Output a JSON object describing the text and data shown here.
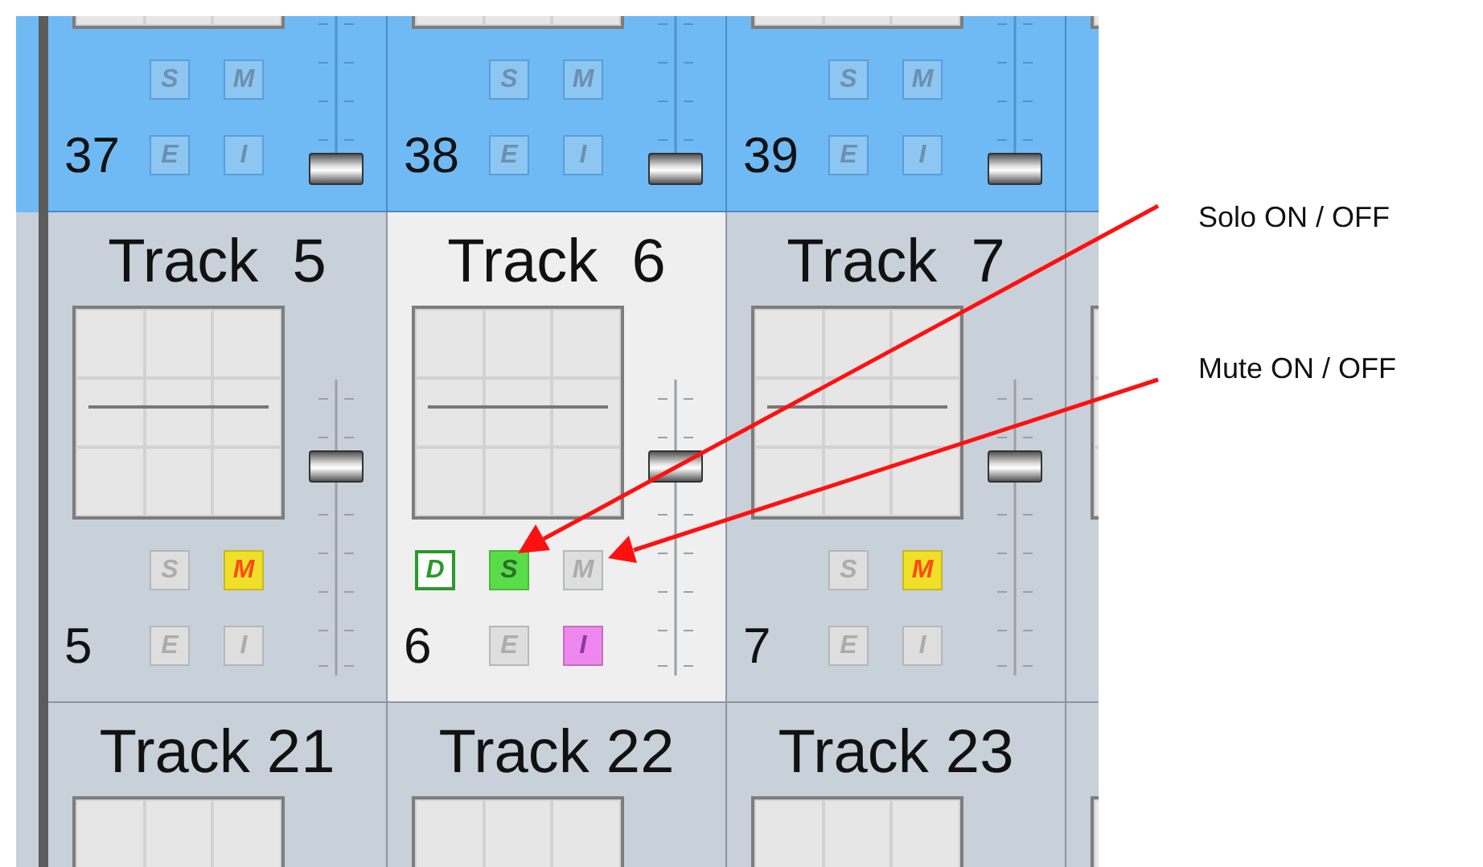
{
  "rows": [
    {
      "highlighted": true,
      "strips": [
        {
          "selected": false,
          "number": "37",
          "fader": {
            "level": 0
          },
          "buttons": [
            {
              "kind": "solo",
              "label": "S",
              "on": false
            },
            {
              "kind": "mute",
              "label": "M",
              "on": false
            },
            {
              "kind": "edit",
              "label": "E",
              "on": false
            },
            {
              "kind": "input",
              "label": "I",
              "on": false
            }
          ]
        },
        {
          "selected": false,
          "number": "38",
          "fader": {
            "level": 0
          },
          "buttons": [
            {
              "kind": "solo",
              "label": "S",
              "on": false
            },
            {
              "kind": "mute",
              "label": "M",
              "on": false
            },
            {
              "kind": "edit",
              "label": "E",
              "on": false
            },
            {
              "kind": "input",
              "label": "I",
              "on": false
            }
          ]
        },
        {
          "selected": false,
          "number": "39",
          "fader": {
            "level": 0
          },
          "buttons": [
            {
              "kind": "solo",
              "label": "S",
              "on": false
            },
            {
              "kind": "mute",
              "label": "M",
              "on": false
            },
            {
              "kind": "edit",
              "label": "E",
              "on": false
            },
            {
              "kind": "input",
              "label": "I",
              "on": false
            }
          ]
        },
        {
          "cut": true
        }
      ]
    },
    {
      "highlighted": false,
      "strips": [
        {
          "selected": false,
          "name": "Track  5",
          "number": "5",
          "fader": {
            "level": 0.73
          },
          "buttons": [
            {
              "kind": "solo",
              "label": "S",
              "on": false
            },
            {
              "kind": "mute",
              "label": "M",
              "on": true
            },
            {
              "kind": "edit",
              "label": "E",
              "on": false
            },
            {
              "kind": "input",
              "label": "I",
              "on": false
            }
          ]
        },
        {
          "selected": true,
          "name": "Track  6",
          "number": "6",
          "fader": {
            "level": 0.73
          },
          "buttons": [
            {
              "kind": "display",
              "label": "D",
              "on": true
            },
            {
              "kind": "solo",
              "label": "S",
              "on": true
            },
            {
              "kind": "mute",
              "label": "M",
              "on": false
            },
            {
              "kind": "edit",
              "label": "E",
              "on": false
            },
            {
              "kind": "input",
              "label": "I",
              "on": true
            }
          ]
        },
        {
          "selected": false,
          "name": "Track  7",
          "number": "7",
          "fader": {
            "level": 0.73
          },
          "buttons": [
            {
              "kind": "solo",
              "label": "S",
              "on": false
            },
            {
              "kind": "mute",
              "label": "M",
              "on": true
            },
            {
              "kind": "edit",
              "label": "E",
              "on": false
            },
            {
              "kind": "input",
              "label": "I",
              "on": false
            }
          ]
        },
        {
          "cut": true
        }
      ]
    },
    {
      "highlighted": false,
      "strips": [
        {
          "selected": false,
          "name": "Track 21"
        },
        {
          "selected": false,
          "name": "Track 22"
        },
        {
          "selected": false,
          "name": "Track 23"
        },
        {
          "cut": true
        }
      ]
    }
  ],
  "annotations": [
    {
      "label": "Solo ON / OFF"
    },
    {
      "label": "Mute ON / OFF"
    }
  ]
}
